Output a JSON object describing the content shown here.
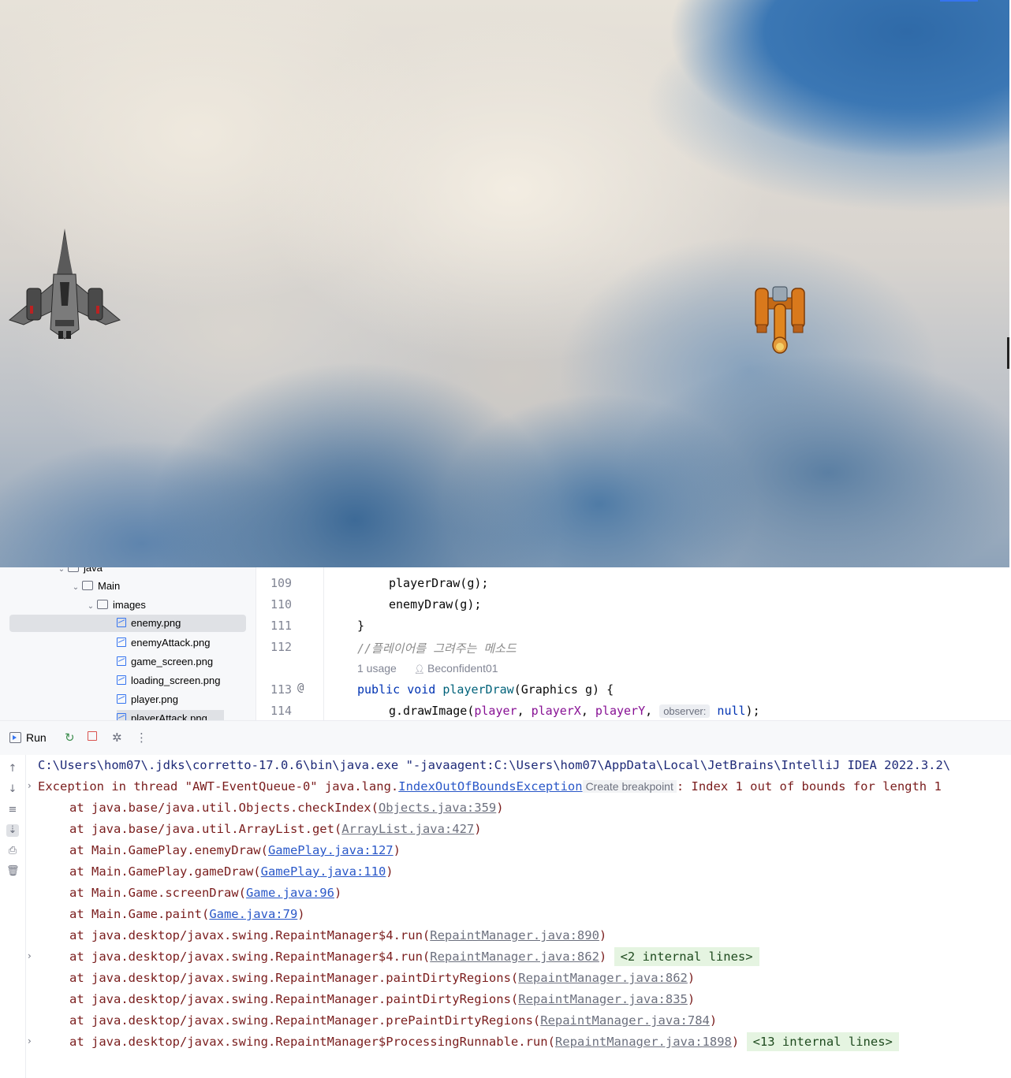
{
  "project_tree": {
    "items": [
      {
        "label": "java",
        "type": "folder"
      },
      {
        "label": "Main",
        "type": "package"
      },
      {
        "label": "images",
        "type": "folder"
      },
      {
        "label": "enemy.png",
        "type": "image",
        "selected": true
      },
      {
        "label": "enemyAttack.png",
        "type": "image"
      },
      {
        "label": "game_screen.png",
        "type": "image"
      },
      {
        "label": "loading_screen.png",
        "type": "image"
      },
      {
        "label": "player.png",
        "type": "image"
      },
      {
        "label": "playerAttack.png",
        "type": "image"
      }
    ]
  },
  "editor": {
    "line_numbers": [
      "109",
      "110",
      "111",
      "112",
      "113",
      "114"
    ],
    "line_109": "playerDraw(g);",
    "line_110": "enemyDraw(g);",
    "line_111": "}",
    "line_112_comment": "//플레이어를 그려주는 메소드",
    "usage_hint": "1 usage",
    "author_hint": "Beconfident01",
    "line_113": {
      "kw1": "public",
      "kw2": "void",
      "fn": "playerDraw",
      "rest": "(Graphics g) {"
    },
    "line_114": {
      "pre": "g.drawImage(",
      "a1": "player",
      "sep1": ", ",
      "a2": "playerX",
      "sep2": ", ",
      "a3": "playerY",
      "sep3": ", ",
      "inlay": "observer:",
      "kw": "null",
      "end": ");"
    },
    "gutter_marker": "@"
  },
  "run_window": {
    "tab_label": "Run",
    "command_line": "C:\\Users\\hom07\\.jdks\\corretto-17.0.6\\bin\\java.exe \"-javaagent:C:\\Users\\hom07\\AppData\\Local\\JetBrains\\IntelliJ IDEA 2022.3.2\\",
    "exception": {
      "prefix": "Exception in thread \"AWT-EventQueue-0\" java.lang.",
      "link": "IndexOutOfBoundsException",
      "breakpoint": "Create breakpoint",
      "suffix": ": Index 1 out of bounds for length 1"
    },
    "trace": [
      {
        "text": "at java.base/java.util.Objects.checkIndex(",
        "link": "Objects.java:359",
        "linkStyle": "gray",
        "end": ")"
      },
      {
        "text": "at java.base/java.util.ArrayList.get(",
        "link": "ArrayList.java:427",
        "linkStyle": "gray",
        "end": ")"
      },
      {
        "text": "at Main.GamePlay.enemyDraw(",
        "link": "GamePlay.java:127",
        "linkStyle": "blue",
        "end": ")"
      },
      {
        "text": "at Main.GamePlay.gameDraw(",
        "link": "GamePlay.java:110",
        "linkStyle": "blue",
        "end": ")"
      },
      {
        "text": "at Main.Game.screenDraw(",
        "link": "Game.java:96",
        "linkStyle": "blue",
        "end": ")"
      },
      {
        "text": "at Main.Game.paint(",
        "link": "Game.java:79",
        "linkStyle": "blue",
        "end": ")"
      },
      {
        "text": "at java.desktop/javax.swing.RepaintManager$4.run(",
        "link": "RepaintManager.java:890",
        "linkStyle": "gray",
        "end": ")"
      },
      {
        "text": "at java.desktop/javax.swing.RepaintManager$4.run(",
        "link": "RepaintManager.java:862",
        "linkStyle": "gray",
        "end": ")",
        "fold": "<2 internal lines>"
      },
      {
        "text": "at java.desktop/javax.swing.RepaintManager.paintDirtyRegions(",
        "link": "RepaintManager.java:862",
        "linkStyle": "gray",
        "end": ")"
      },
      {
        "text": "at java.desktop/javax.swing.RepaintManager.paintDirtyRegions(",
        "link": "RepaintManager.java:835",
        "linkStyle": "gray",
        "end": ")"
      },
      {
        "text": "at java.desktop/javax.swing.RepaintManager.prePaintDirtyRegions(",
        "link": "RepaintManager.java:784",
        "linkStyle": "gray",
        "end": ")"
      },
      {
        "text": "at java.desktop/javax.swing.RepaintManager$ProcessingRunnable.run(",
        "link": "RepaintManager.java:1898",
        "linkStyle": "gray",
        "end": ")",
        "fold": "<13 internal lines>"
      }
    ]
  },
  "colors": {
    "error_text": "#7a1d1d",
    "link_blue": "#2a58c8",
    "fold_bg": "#e5f4e1",
    "accent": "#3574f0"
  }
}
